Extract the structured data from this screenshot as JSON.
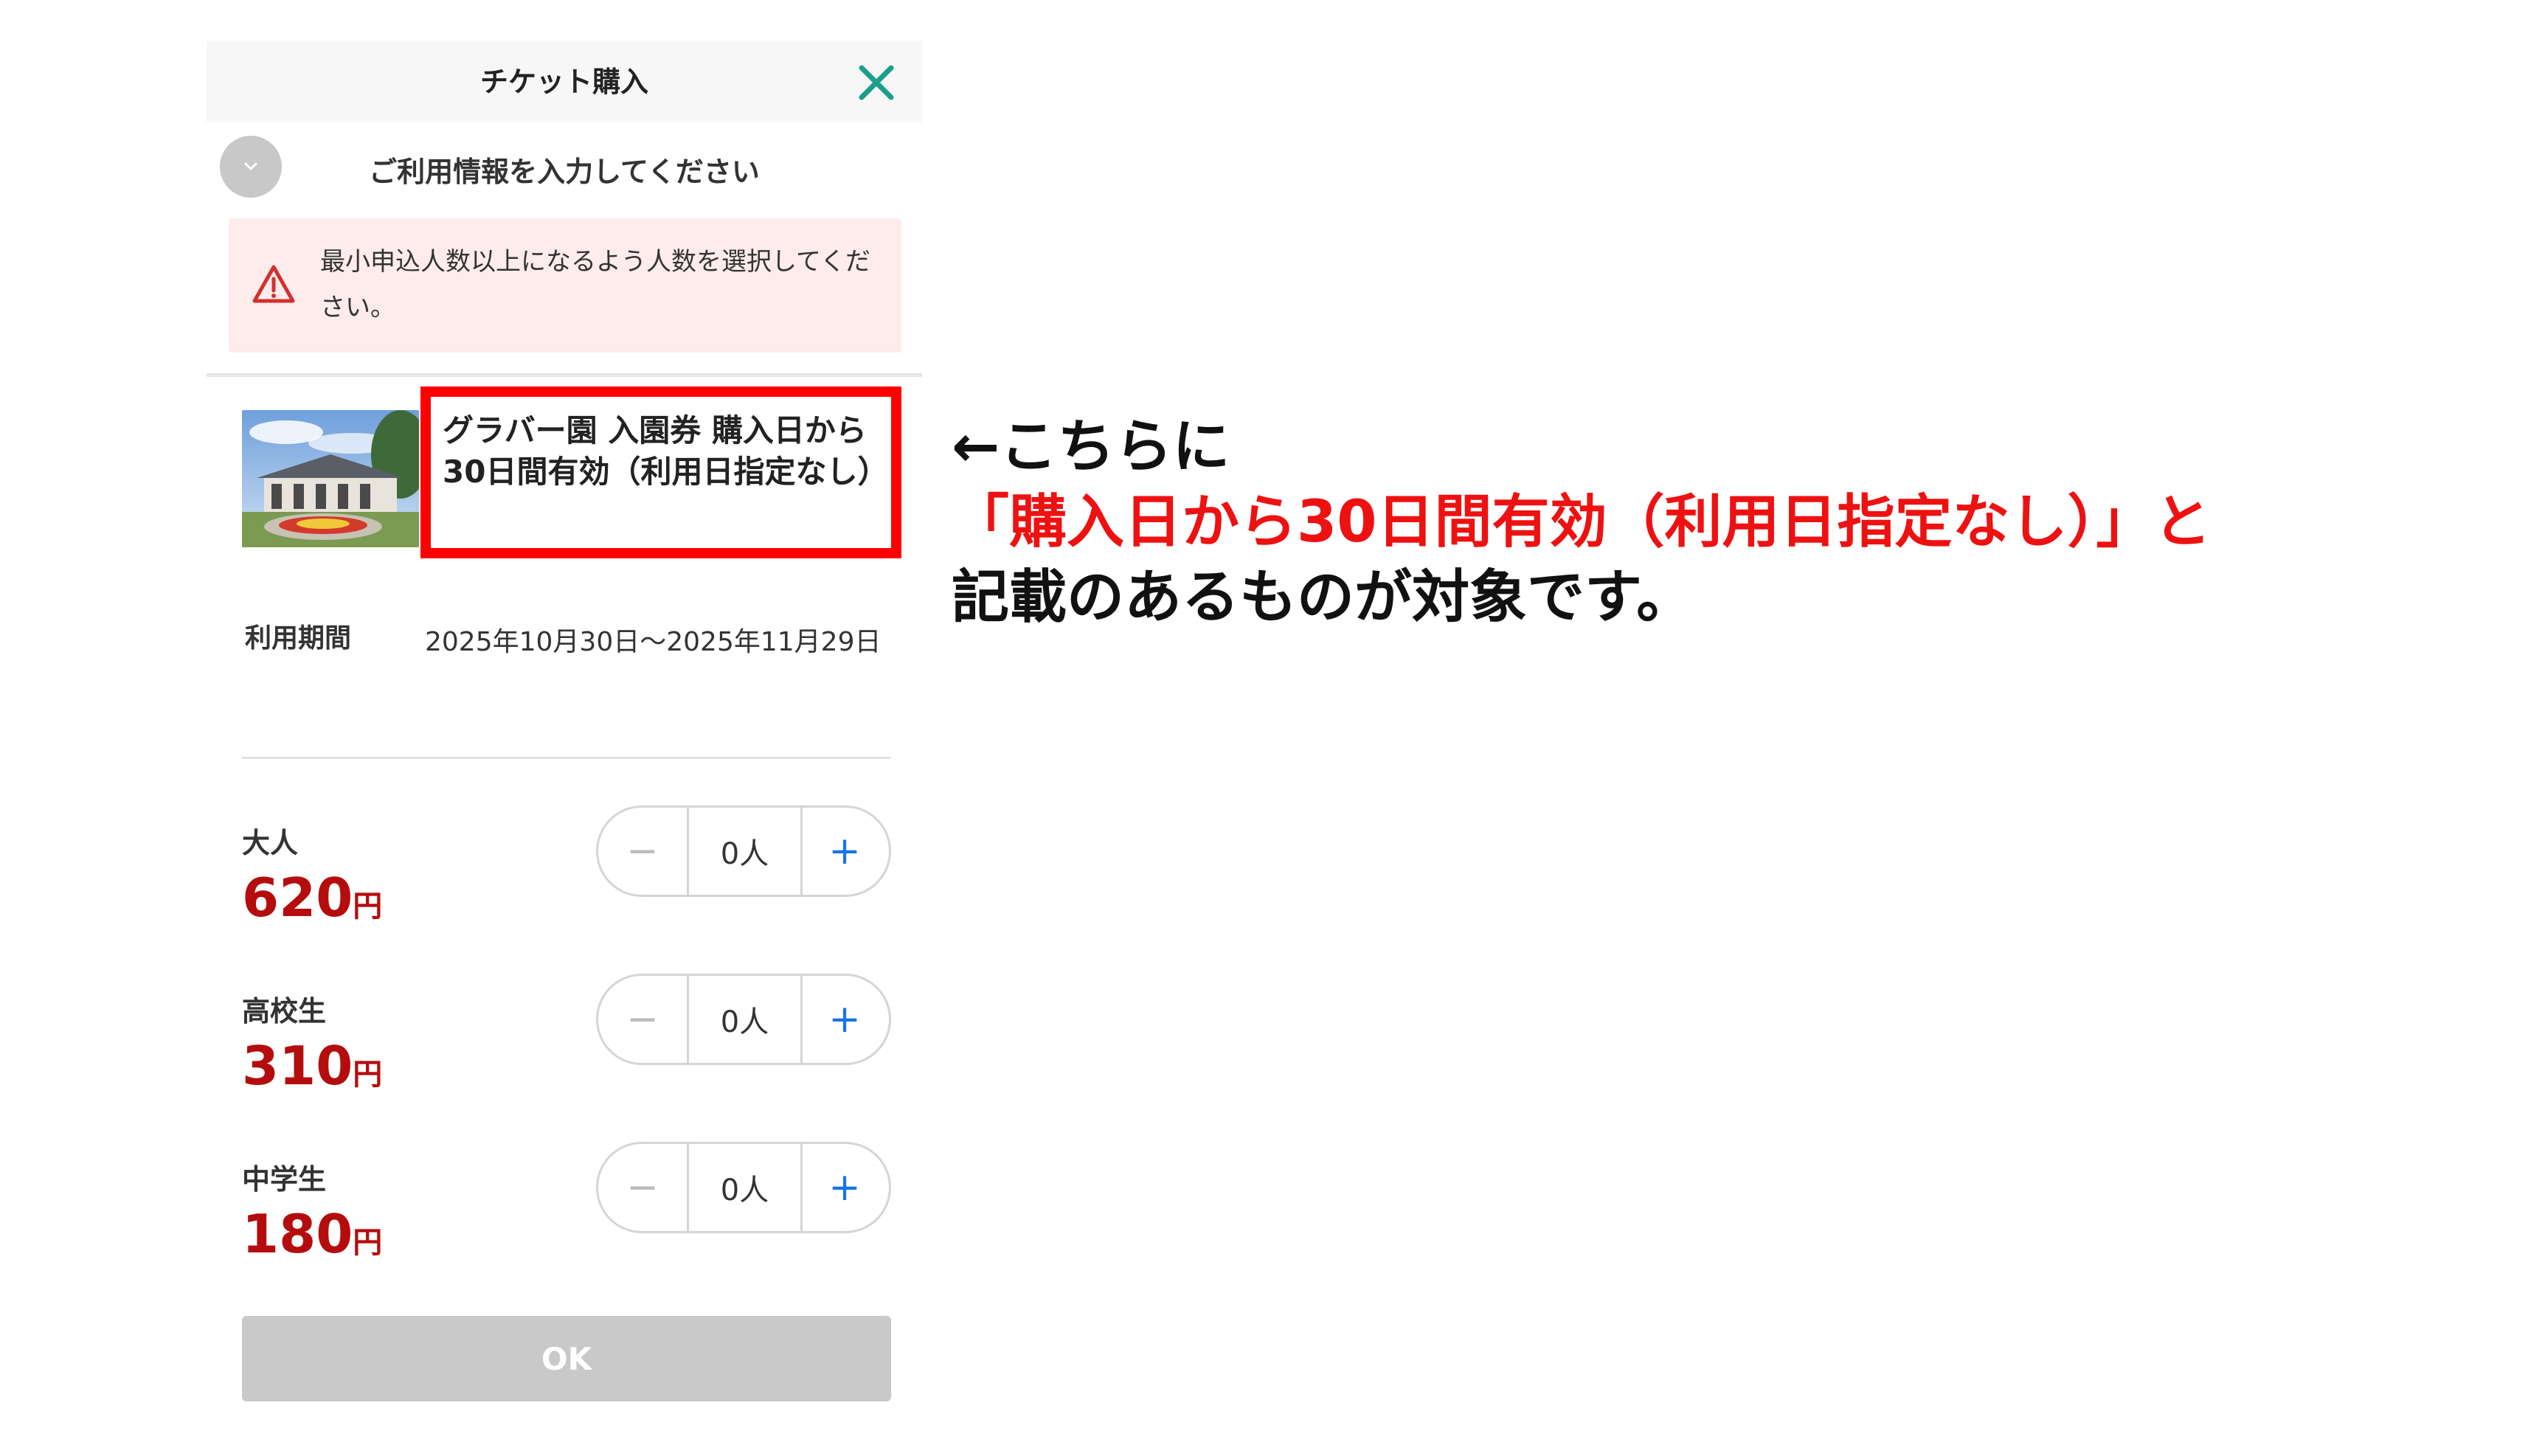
{
  "header": {
    "title": "チケット購入",
    "close_icon": "close-icon",
    "close_color": "#1aa08a"
  },
  "section": {
    "title": "ご利用情報を入力してください",
    "toggle_icon": "chevron-down-icon"
  },
  "alert": {
    "icon": "warning-triangle-icon",
    "text": "最小申込人数以上になるよう人数を選択してください。",
    "background": "#fdeceb",
    "icon_color": "#d32f2f"
  },
  "product": {
    "image": "garden-building-photo",
    "title": "グラバー園 入園券 購入日から30日間有効（利用日指定なし）",
    "period_label": "利用期間",
    "period_value": "2025年10月30日〜2025年11月29日"
  },
  "tickets": [
    {
      "name": "大人",
      "price": "620",
      "unit": "円",
      "count": "0人"
    },
    {
      "name": "高校生",
      "price": "310",
      "unit": "円",
      "count": "0人"
    },
    {
      "name": "中学生",
      "price": "180",
      "unit": "円",
      "count": "0人"
    }
  ],
  "stepper": {
    "minus": "−",
    "plus": "+"
  },
  "ok_button": {
    "label": "OK"
  },
  "annotation": {
    "line1": "←こちらに",
    "line2": "「購入日から30日間有効（利用日指定なし）」と",
    "line3": "記載のあるものが対象です。",
    "highlight_color": "#ff0000"
  },
  "colors": {
    "price": "#b50d0d",
    "plus": "#1a73e8",
    "ok_disabled": "#c9c9c9"
  }
}
